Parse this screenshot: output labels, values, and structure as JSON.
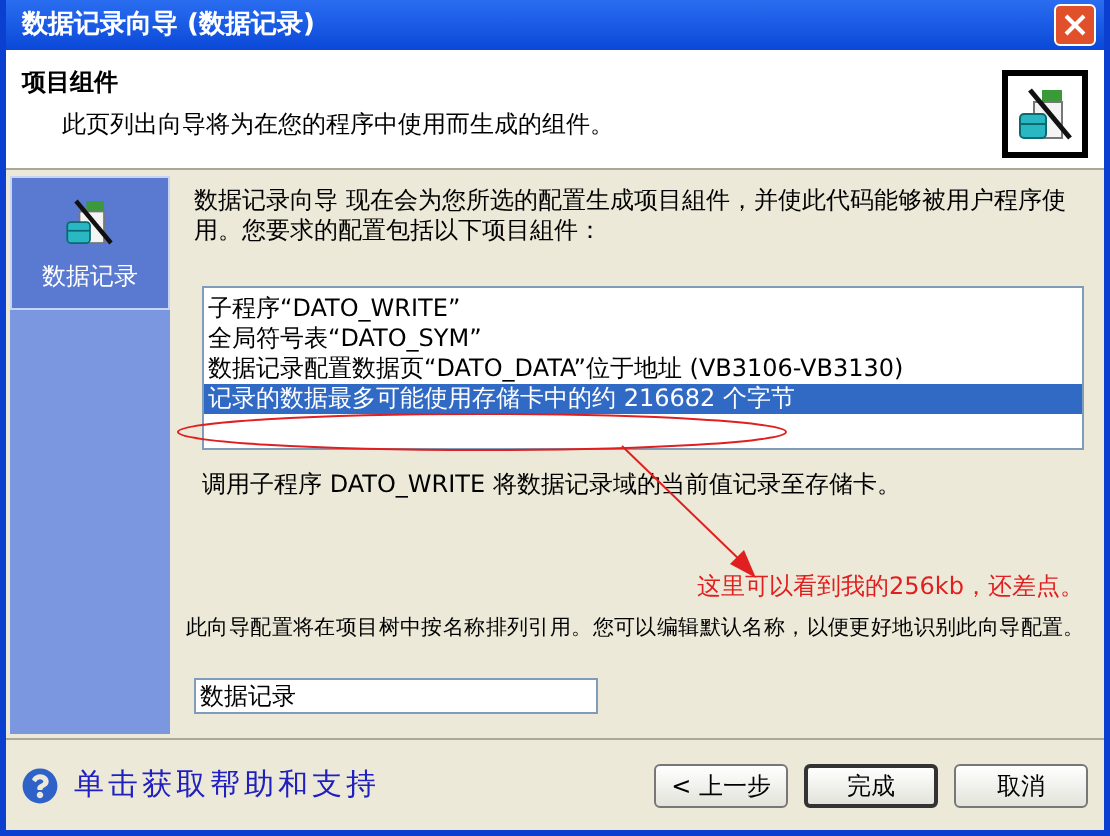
{
  "window": {
    "title": "数据记录向导 (数据记录)"
  },
  "header": {
    "title": "项目组件",
    "subtitle": "此页列出向导将为在您的程序中使用而生成的组件。"
  },
  "sidebar": {
    "items": [
      {
        "label": "数据记录",
        "selected": true
      }
    ]
  },
  "intro": "数据记录向导 现在会为您所选的配置生成项目組件，并使此代码能够被用户程序使用。您要求的配置包括以下项目組件：",
  "components": [
    {
      "text": "子程序“DATO_WRITE”",
      "selected": false
    },
    {
      "text": "全局符号表“DATO_SYM”",
      "selected": false
    },
    {
      "text": "数据记录配置数据页“DATO_DATA”位于地址 (VB3106-VB3130)",
      "selected": false
    },
    {
      "text": "记录的数据最多可能使用存储卡中的约 216682 个字节",
      "selected": true
    }
  ],
  "call_note": "调用子程序 DATO_WRITE 将数据记录域的当前值记录至存储卡。",
  "annotation": "这里可以看到我的256kb，还差点。",
  "naming_note": "此向导配置将在项目树中按名称排列引用。您可以编辑默认名称，以便更好地识别此向导配置。",
  "name_field": {
    "value": "数据记录"
  },
  "help_link": "单击获取帮助和支持",
  "buttons": [
    {
      "label": "< 上一步",
      "default": false
    },
    {
      "label": "完成",
      "default": true
    },
    {
      "label": "取消",
      "default": false
    }
  ]
}
